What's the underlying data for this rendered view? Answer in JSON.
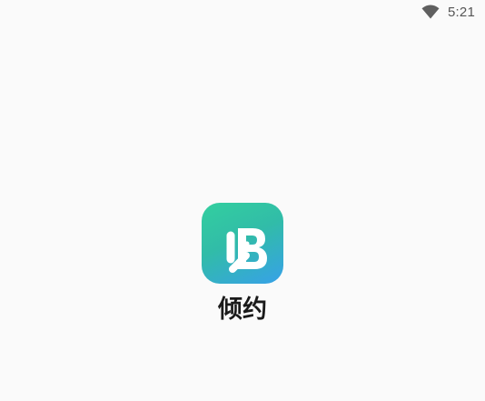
{
  "status_bar": {
    "time": "5:21",
    "wifi_icon": "wifi-icon",
    "color": "#555555"
  },
  "splash": {
    "app_name": "倾约",
    "logo_icon": "app-logo-icon",
    "logo_gradient": [
      "#33cf9f",
      "#31bca8",
      "#37a1e8"
    ],
    "background": "#fafafa"
  }
}
